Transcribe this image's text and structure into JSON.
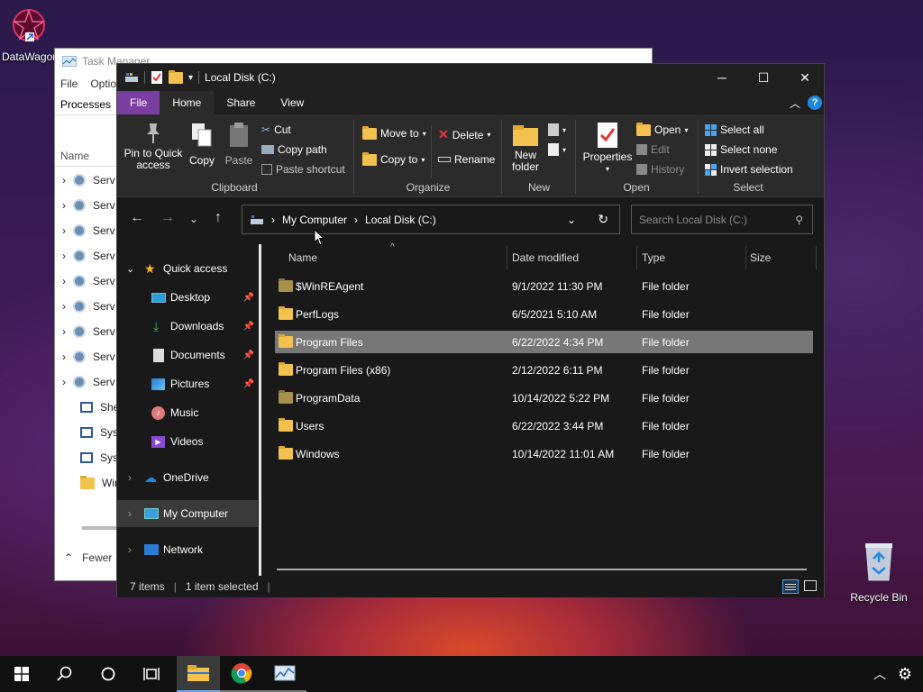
{
  "desktop": {
    "datawagon_label": "DataWagor",
    "recycle_bin_label": "Recycle Bin"
  },
  "task_manager": {
    "title": "Task Manager",
    "menu": [
      "File",
      "Optio"
    ],
    "tab": "Processes",
    "name_col": "Name",
    "rows": [
      "Serv",
      "Serv",
      "Serv",
      "Serv",
      "Serv",
      "Serv",
      "Serv",
      "Serv",
      "Serv",
      "Shel",
      "Syst",
      "Syst",
      "Win"
    ],
    "fewer": "Fewer"
  },
  "explorer": {
    "title": "Local Disk (C:)",
    "tabs": {
      "file": "File",
      "home": "Home",
      "share": "Share",
      "view": "View"
    },
    "ribbon": {
      "pin": "Pin to Quick access",
      "copy": "Copy",
      "paste": "Paste",
      "cut": "Cut",
      "copy_path": "Copy path",
      "paste_shortcut": "Paste shortcut",
      "clipboard": "Clipboard",
      "move_to": "Move to",
      "copy_to": "Copy to",
      "delete": "Delete",
      "rename": "Rename",
      "organize": "Organize",
      "new_folder": "New folder",
      "new": "New",
      "properties": "Properties",
      "open": "Open",
      "edit": "Edit",
      "history": "History",
      "open_group": "Open",
      "select_all": "Select all",
      "select_none": "Select none",
      "invert_selection": "Invert selection",
      "select": "Select"
    },
    "address": {
      "crumb1": "My Computer",
      "crumb2": "Local Disk (C:)"
    },
    "search": {
      "placeholder": "Search Local Disk (C:)"
    },
    "nav": {
      "quick_access": "Quick access",
      "desktop": "Desktop",
      "downloads": "Downloads",
      "documents": "Documents",
      "pictures": "Pictures",
      "music": "Music",
      "videos": "Videos",
      "onedrive": "OneDrive",
      "my_computer": "My Computer",
      "network": "Network"
    },
    "columns": {
      "name": "Name",
      "date": "Date modified",
      "type": "Type",
      "size": "Size"
    },
    "files": [
      {
        "name": "$WinREAgent",
        "date": "9/1/2022 11:30 PM",
        "type": "File folder"
      },
      {
        "name": "PerfLogs",
        "date": "6/5/2021 5:10 AM",
        "type": "File folder"
      },
      {
        "name": "Program Files",
        "date": "6/22/2022 4:34 PM",
        "type": "File folder"
      },
      {
        "name": "Program Files (x86)",
        "date": "2/12/2022 6:11 PM",
        "type": "File folder"
      },
      {
        "name": "ProgramData",
        "date": "10/14/2022 5:22 PM",
        "type": "File folder"
      },
      {
        "name": "Users",
        "date": "6/22/2022 3:44 PM",
        "type": "File folder"
      },
      {
        "name": "Windows",
        "date": "10/14/2022 11:01 AM",
        "type": "File folder"
      }
    ],
    "status": {
      "items": "7 items",
      "selected": "1 item selected"
    }
  },
  "colors": {
    "accent_file_tab": "#7a3ea0",
    "folder": "#f2c14e",
    "selected_row": "#777777"
  }
}
